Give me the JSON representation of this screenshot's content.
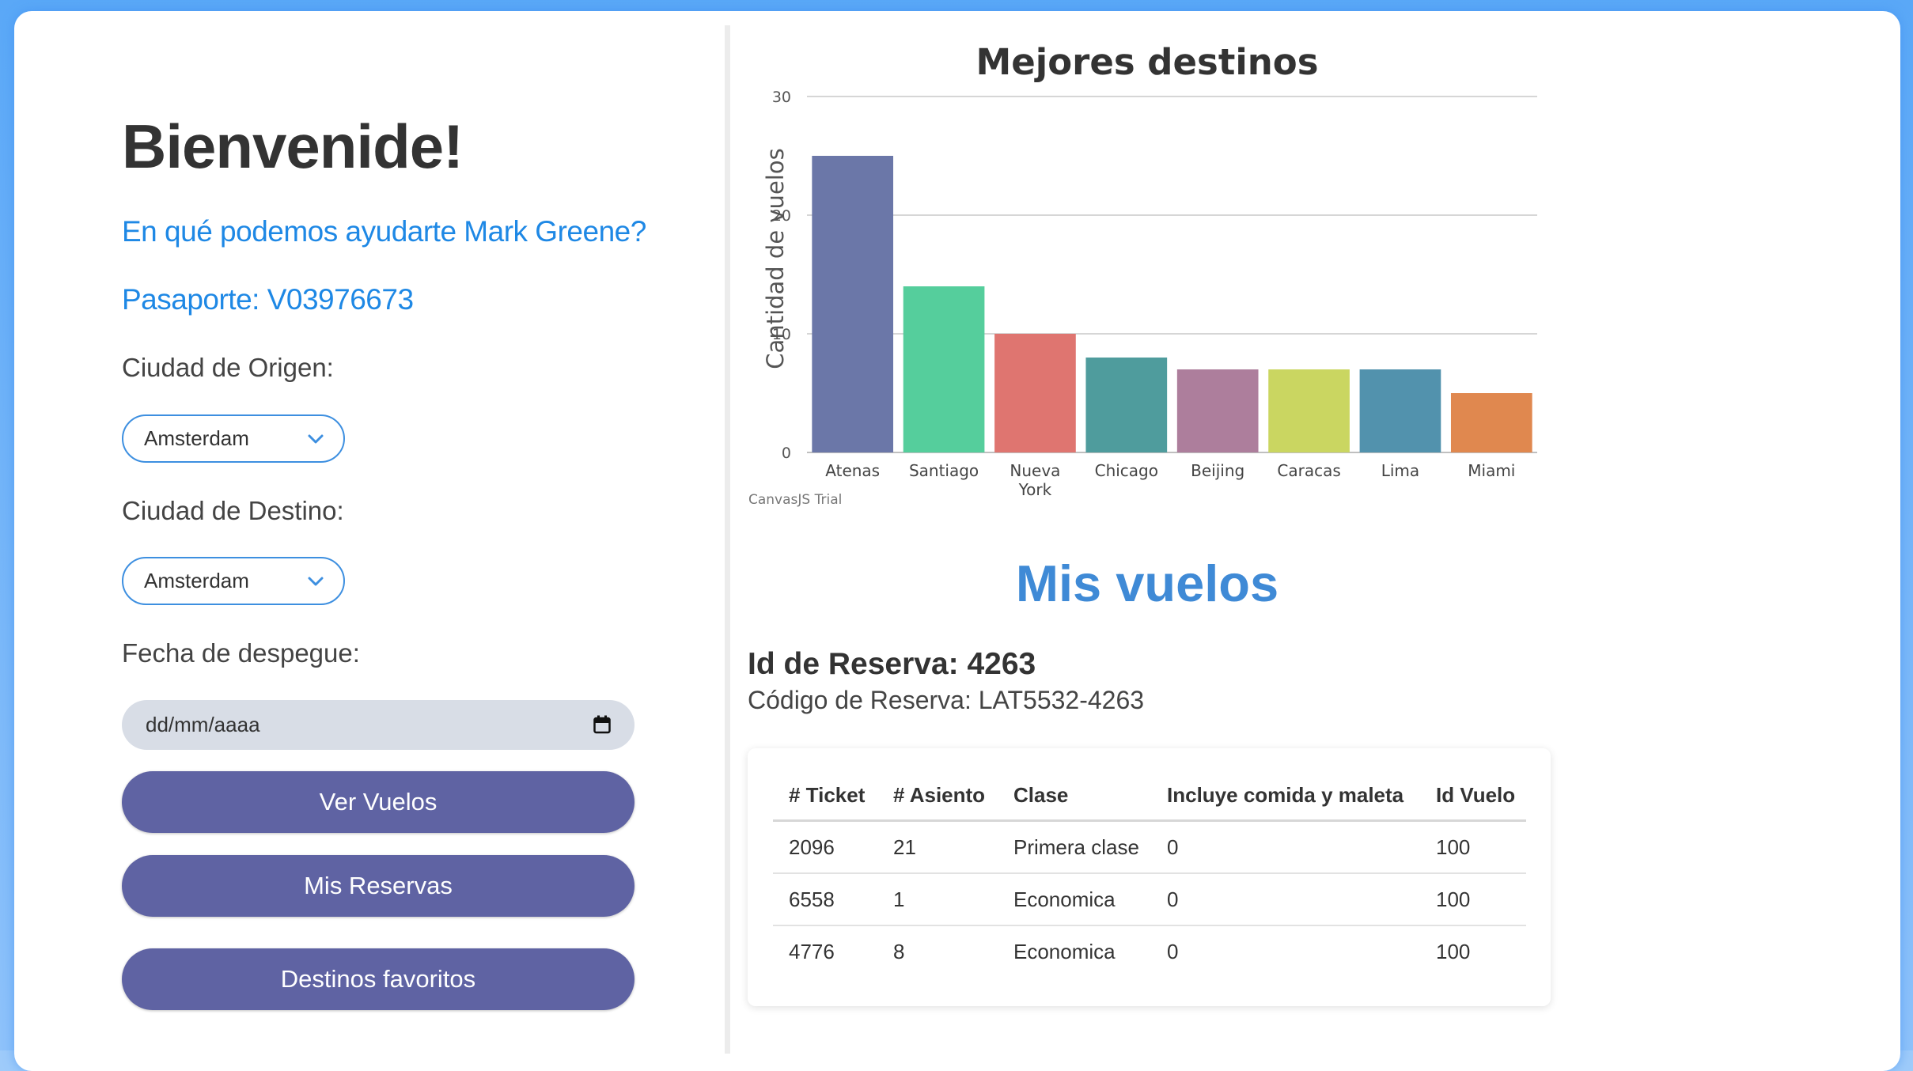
{
  "welcome": {
    "title": "Bienvenide!",
    "greeting": "En qué podemos ayudarte Mark Greene?",
    "passport": "Pasaporte: V03976673"
  },
  "form": {
    "origin_label": "Ciudad de Origen:",
    "origin_value": "Amsterdam",
    "destination_label": "Ciudad de Destino:",
    "destination_value": "Amsterdam",
    "date_label": "Fecha de despegue:",
    "date_placeholder": "dd/mm/aaaa"
  },
  "buttons": {
    "view_flights": "Ver Vuelos",
    "my_bookings": "Mis Reservas",
    "favorite_destinations": "Destinos favoritos"
  },
  "chart_data": {
    "type": "bar",
    "title": "Mejores destinos",
    "xlabel": "",
    "ylabel": "Cantidad de vuelos",
    "categories": [
      "Atenas",
      "Santiago",
      "Nueva York",
      "Chicago",
      "Beijing",
      "Caracas",
      "Lima",
      "Miami"
    ],
    "values": [
      25,
      14,
      10,
      8,
      7,
      7,
      7,
      5
    ],
    "colors": [
      "#6b77a8",
      "#55ce9c",
      "#df7570",
      "#4f9c9d",
      "#ad7e9c",
      "#cad661",
      "#5292ad",
      "#e0884f"
    ],
    "ylim": [
      0,
      30
    ],
    "yticks": [
      0,
      10,
      20,
      30
    ],
    "grid": true,
    "watermark": "CanvasJS Trial"
  },
  "bookings": {
    "title": "Mis vuelos",
    "reservation_id": "Id de Reserva: 4263",
    "reservation_code": "Código de Reserva: LAT5532-4263",
    "columns": [
      "# Ticket",
      "# Asiento",
      "Clase",
      "Incluye comida y maleta",
      "Id Vuelo"
    ],
    "rows": [
      [
        "2096",
        "21",
        "Primera clase",
        "0",
        "100"
      ],
      [
        "6558",
        "1",
        "Economica",
        "0",
        "100"
      ],
      [
        "4776",
        "8",
        "Economica",
        "0",
        "100"
      ]
    ]
  }
}
